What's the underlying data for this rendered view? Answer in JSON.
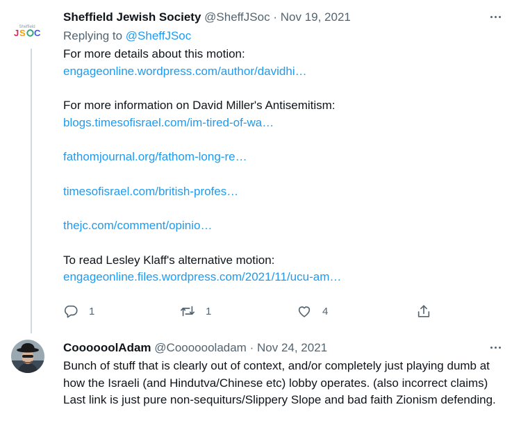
{
  "tweet1": {
    "avatar_text_top": "Sheffield",
    "avatar_text_main": "JS☼C",
    "display_name": "Sheffield Jewish Society",
    "handle": "@SheffJSoc",
    "separator": "·",
    "date": "Nov 19, 2021",
    "replying_label": "Replying to",
    "replying_to": "@SheffJSoc",
    "line1": "For more details about this motion:",
    "link1": "engageonline.wordpress.com/author/davidhi…",
    "line2": "For more information on David Miller's Antisemitism:",
    "link2": "blogs.timesofisrael.com/im-tired-of-wa…",
    "link3": "fathomjournal.org/fathom-long-re…",
    "link4": "timesofisrael.com/british-profes…",
    "link5": "thejc.com/comment/opinio…",
    "line3": "To read Lesley Klaff's alternative motion:",
    "link6": "engageonline.files.wordpress.com/2021/11/ucu-am…",
    "reply_count": "1",
    "retweet_count": "1",
    "like_count": "4"
  },
  "tweet2": {
    "display_name": "CoooooolAdam",
    "handle": "@Cooooooladam",
    "separator": "·",
    "date": "Nov 24, 2021",
    "line1": "Bunch of stuff that is clearly out of context, and/or completely just playing dumb at how the Israeli (and Hindutva/Chinese etc) lobby operates. (also incorrect claims)",
    "line2": "Last link is just pure non-sequiturs/Slippery Slope and bad faith Zionism defending."
  },
  "colors": {
    "link": "#1d9bf0",
    "secondary_text": "#536471",
    "thread_line": "#cfd9de"
  },
  "icons": {
    "reply": "reply-icon",
    "retweet": "retweet-icon",
    "like": "heart-icon",
    "share": "share-icon",
    "more": "more-icon"
  }
}
